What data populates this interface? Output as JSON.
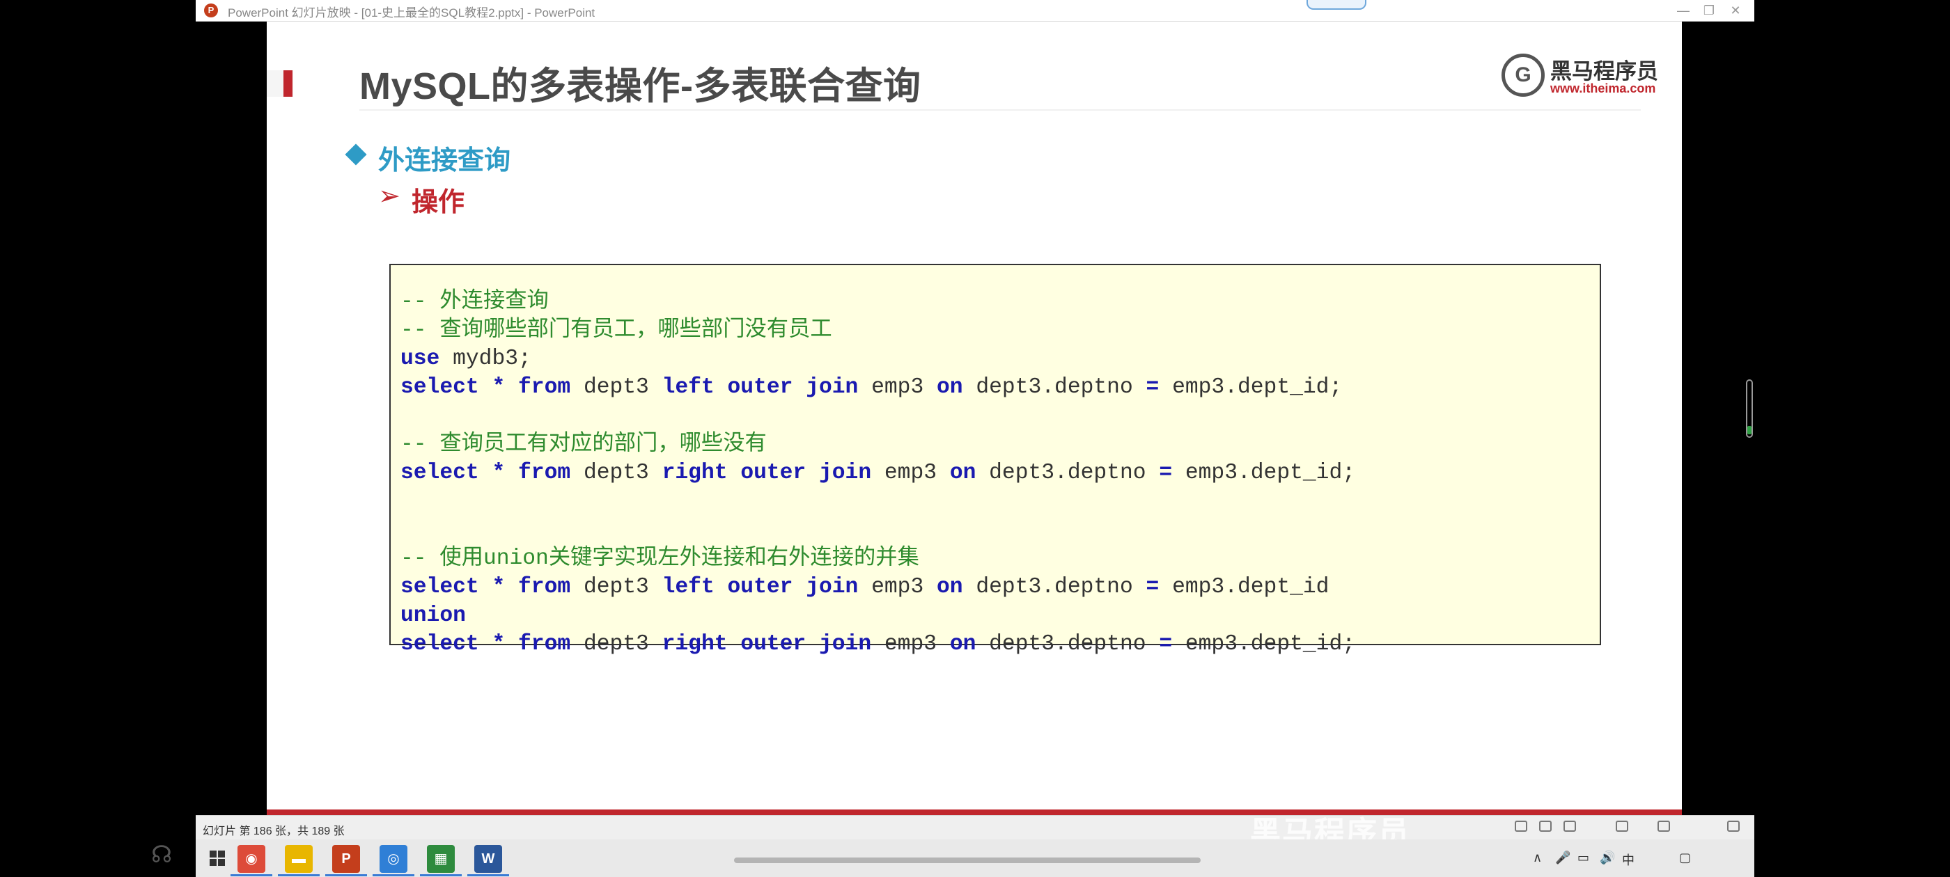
{
  "window": {
    "title": "PowerPoint 幻灯片放映 - [01-史上最全的SQL教程2.pptx] - PowerPoint",
    "app_icon_letter": "P",
    "minimize": "—",
    "restore": "❐",
    "close": "✕"
  },
  "slide": {
    "title": "MySQL的多表操作-多表联合查询",
    "logo": {
      "mark": "G",
      "name": "黑马程序员",
      "url": "www.itheima.com"
    },
    "heading": "外连接查询",
    "subheading_marker": "➢",
    "subheading": "操作",
    "code_lines": [
      "-- 外连接查询",
      "-- 查询哪些部门有员工，哪些部门没有员工",
      "use mydb3;",
      "select * from dept3 left outer join emp3 on dept3.deptno = emp3.dept_id;",
      "",
      "-- 查询员工有对应的部门，哪些没有",
      "select * from dept3 right outer join emp3 on dept3.deptno = emp3.dept_id;",
      "",
      "",
      "-- 使用union关键字实现左外连接和右外连接的并集",
      "select * from dept3 left outer join emp3 on dept3.deptno = emp3.dept_id",
      "union",
      "select * from dept3 right outer join emp3 on dept3.deptno = emp3.dept_id;"
    ],
    "sql_keywords": [
      "select",
      "*",
      "from",
      "left",
      "right",
      "outer",
      "join",
      "on",
      "=",
      "use",
      "union"
    ]
  },
  "status_bar": {
    "slide_position": "幻灯片 第 186 张，共 189 张",
    "watermark": "黑马程序员"
  },
  "taskbar": {
    "apps": [
      {
        "name": "chrome",
        "glyph": "◉",
        "color": "#dd4b39"
      },
      {
        "name": "file-explorer",
        "glyph": "▬",
        "color": "#e8b600"
      },
      {
        "name": "powerpoint",
        "glyph": "P",
        "color": "#c43e1c"
      },
      {
        "name": "browser",
        "glyph": "◎",
        "color": "#2f7fd6"
      },
      {
        "name": "spreadsheet",
        "glyph": "▦",
        "color": "#2e8b3e"
      },
      {
        "name": "word",
        "glyph": "W",
        "color": "#2b579a"
      }
    ],
    "tray": [
      "∧",
      "🎤",
      "▭",
      "🔊",
      "中",
      "▢"
    ]
  },
  "colors": {
    "accent_red": "#c0262d",
    "heading_blue": "#2e9bc6",
    "code_bg": "#ffffe1",
    "keyword_blue": "#1a1ab0",
    "comment_green": "#2e8b2e"
  }
}
